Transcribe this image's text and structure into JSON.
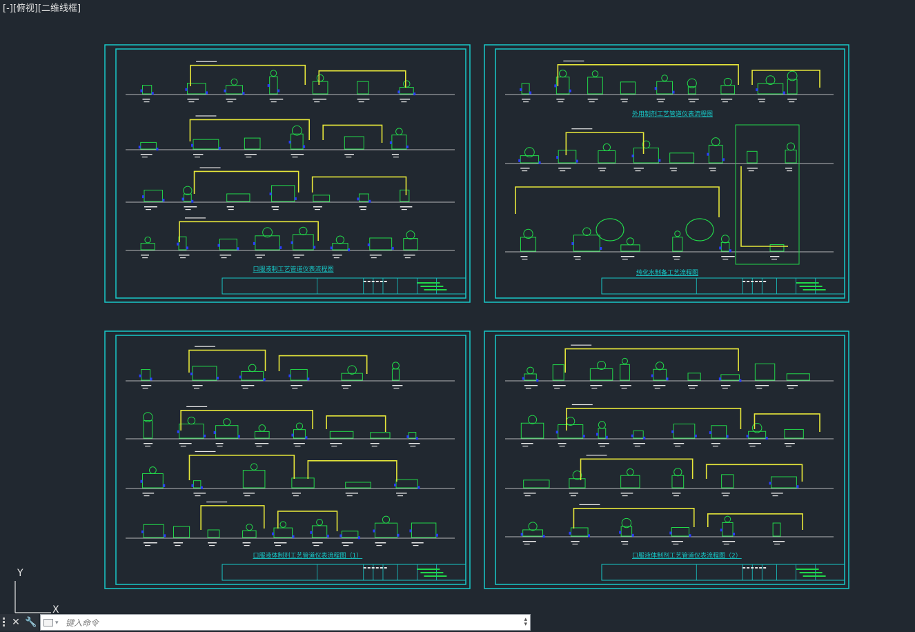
{
  "view_controls": {
    "label": "[-][俯视][二维线框]"
  },
  "ucs": {
    "y_label": "Y",
    "x_label": "X"
  },
  "command_line": {
    "placeholder": "键入命令",
    "close_glyph": "✕",
    "customize_glyph": "🔧"
  },
  "colors": {
    "background": "#212830",
    "sheet_border": "#18c8c8",
    "equipment": "#22d84a",
    "pipe": "#e6e63a",
    "valve": "#2a3cff",
    "baseline": "#e8e8e8"
  },
  "sheets": [
    {
      "id": "sheet-1",
      "title": "口服液制工艺管道仪表流程图"
    },
    {
      "id": "sheet-2",
      "title": "外用制剂工艺管道仪表流程图",
      "subtitle": "纯化水制备工艺流程图"
    },
    {
      "id": "sheet-3",
      "title": "口服液体制剂工艺管道仪表流程图（1）"
    },
    {
      "id": "sheet-4",
      "title": "口服液体制剂工艺管道仪表流程图（2）"
    }
  ]
}
